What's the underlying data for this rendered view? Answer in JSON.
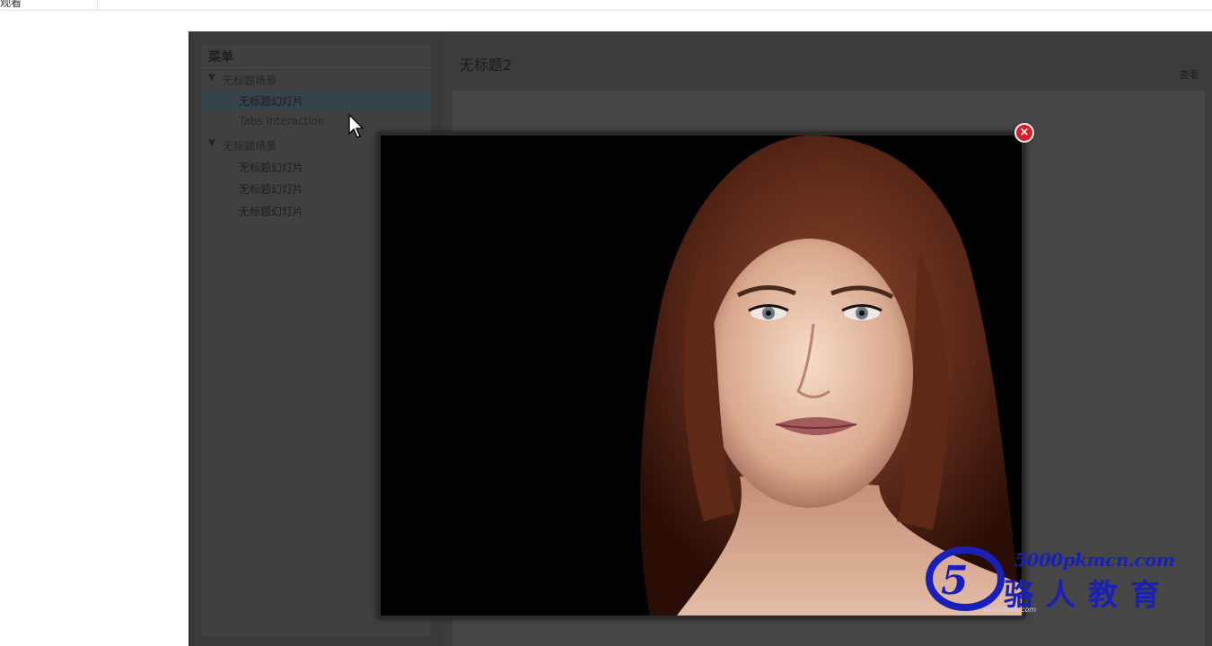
{
  "window": {
    "title_fragment": "观看"
  },
  "sidebar": {
    "menu_title": "菜单",
    "groups": [
      {
        "label": "无标题场景",
        "items": [
          {
            "label": "无标题幻灯片",
            "selected": true
          },
          {
            "label": "Tabs Interaction",
            "selected": false
          }
        ]
      },
      {
        "label": "无标题场景",
        "items": [
          {
            "label": "无标题幻灯片",
            "selected": false
          },
          {
            "label": "无标题幻灯片",
            "selected": false
          },
          {
            "label": "无标题幻灯片",
            "selected": false
          }
        ]
      }
    ]
  },
  "main": {
    "title": "无标题2",
    "right_label": "查看"
  },
  "lightbox": {
    "close_label": "×",
    "image_credit": "www.tuku.com"
  },
  "watermark": {
    "url": "5000pkmcn.com",
    "name": "骆人教育"
  },
  "colors": {
    "close_button": "#d5202a",
    "selected_item": "#35434a",
    "watermark": "#1a1fb8"
  }
}
